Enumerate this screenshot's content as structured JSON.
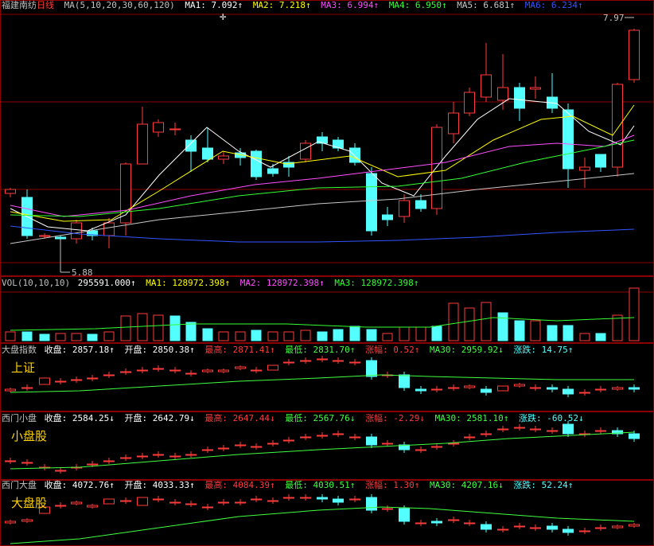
{
  "colors": {
    "up": "#ff3b3b",
    "down": "#54ffff",
    "grid": "#8b0000",
    "ma1": "#ffffff",
    "ma2": "#ffff00",
    "ma3": "#ff4dff",
    "ma4": "#33ff33",
    "ma5": "#c8c8c8",
    "ma6": "#3355ff",
    "label": "#c0c0c0",
    "yellow": "#ffd200",
    "green": "#40ff40"
  },
  "main": {
    "stock_name": "福建南纺",
    "period": "日线",
    "ma_params": "MA(5,10,20,30,60,120)",
    "ma1": "MA1: 7.092↑",
    "ma2": "MA2: 7.218↑",
    "ma3": "MA3: 6.994↑",
    "ma4": "MA4: 6.950↑",
    "ma5": "MA5: 6.681↑",
    "ma6": "MA6: 6.234↑",
    "high_mark": "7.97",
    "low_mark": "5.88"
  },
  "vol": {
    "title": "VOL(10,10,10)",
    "value": "295591.000↑",
    "ma1": "MA1: 128972.398↑",
    "ma2": "MA2: 128972.398↑",
    "ma3": "MA3: 128972.398↑"
  },
  "idx1": {
    "name": "大盘指数",
    "close": "收盘: 2857.18↑",
    "open": "开盘: 2850.38↑",
    "high": "最高: 2871.41↑",
    "low": "最低: 2831.70↑",
    "chg": "涨幅: 0.52↑",
    "ma30": "MA30: 2959.92↓",
    "diff": "涨跌: 14.75↑",
    "big": "上证"
  },
  "idx2": {
    "name": "西门小盘",
    "close": "收盘: 2584.25↓",
    "open": "开盘: 2642.79↓",
    "high": "最高: 2647.44↓",
    "low": "最低: 2567.76↓",
    "chg": "涨幅: -2.29↓",
    "ma30": "MA30: 2581.10↑",
    "diff": "涨跌: -60.52↓",
    "big": "小盘股"
  },
  "idx3": {
    "name": "西门大盘",
    "close": "收盘: 4072.76↑",
    "open": "开盘: 4033.33↑",
    "high": "最高: 4084.39↑",
    "low": "最低: 4030.51↑",
    "chg": "涨幅: 1.30↑",
    "ma30": "MA30: 4207.16↓",
    "diff": "涨跌: 52.24↑",
    "big": "大盘股"
  }
}
